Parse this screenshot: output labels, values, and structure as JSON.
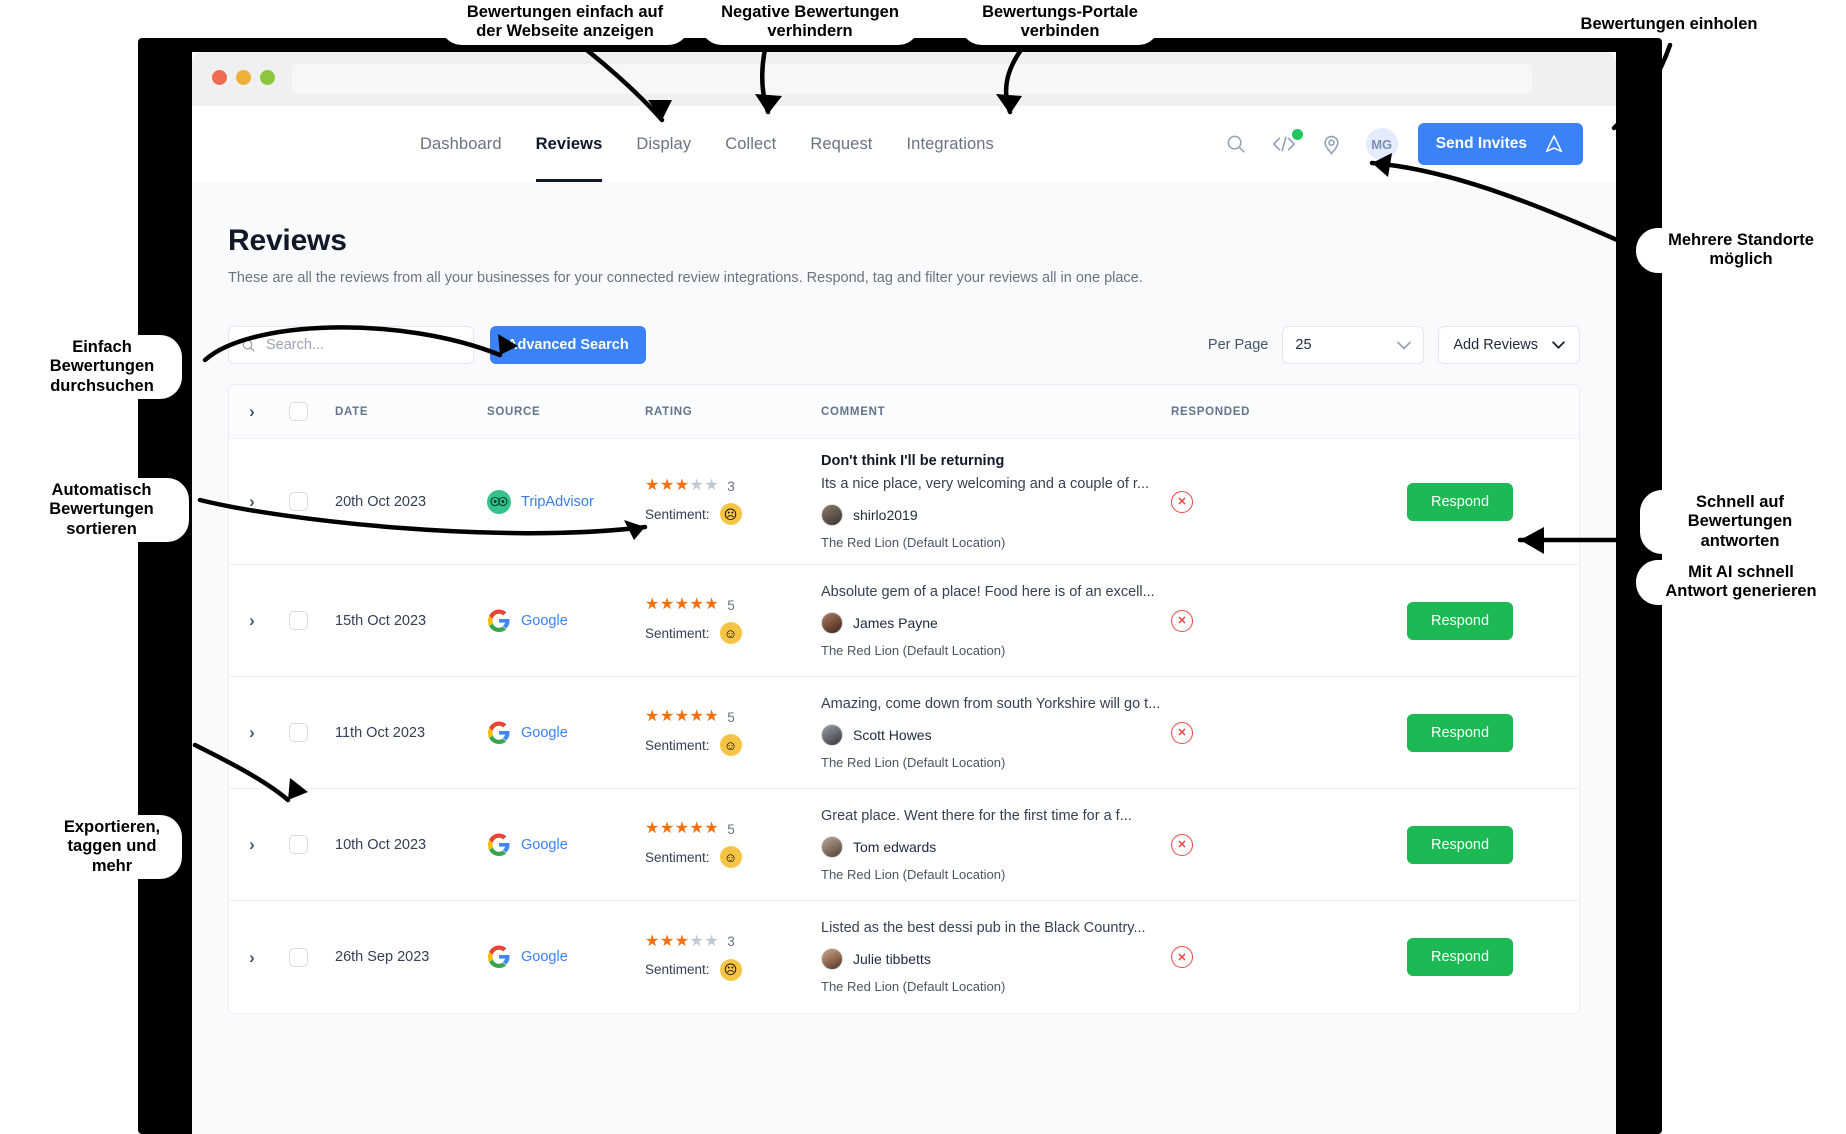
{
  "browser": {
    "traffic_lights": [
      "close-red",
      "minimize-yellow",
      "maximize-green"
    ],
    "url_value": ""
  },
  "nav": {
    "items": [
      {
        "label": "Dashboard",
        "active": false
      },
      {
        "label": "Reviews",
        "active": true
      },
      {
        "label": "Display",
        "active": false
      },
      {
        "label": "Collect",
        "active": false
      },
      {
        "label": "Request",
        "active": false
      },
      {
        "label": "Integrations",
        "active": false
      }
    ],
    "icons": [
      "search-icon",
      "code-embed-icon",
      "location-pin-icon"
    ],
    "status_dot_color": "#22c55e",
    "avatar_initials": "MG",
    "send_invites_label": "Send Invites"
  },
  "page": {
    "title": "Reviews",
    "subtitle": "These are all the reviews from all your businesses for your connected review integrations. Respond, tag and filter your reviews all in one place."
  },
  "filters": {
    "search_placeholder": "Search...",
    "search_value": "",
    "advanced_search_label": "Advanced Search",
    "per_page_label": "Per Page",
    "per_page_value": "25",
    "add_reviews_label": "Add Reviews"
  },
  "table": {
    "columns": [
      "DATE",
      "SOURCE",
      "RATING",
      "COMMENT",
      "RESPONDED"
    ],
    "sentiment_label": "Sentiment:",
    "respond_label": "Respond",
    "rows": [
      {
        "date": "20th Oct 2023",
        "source": "TripAdvisor",
        "source_kind": "tripadvisor",
        "rating": 3,
        "rating_max": 5,
        "sentiment": "negative",
        "comment_title": "Don't think I'll be returning",
        "comment_text": "Its a nice place, very welcoming and a couple of r...",
        "author": "shirlo2019",
        "location": "The Red Lion (Default Location)",
        "responded": false
      },
      {
        "date": "15th Oct 2023",
        "source": "Google",
        "source_kind": "google",
        "rating": 5,
        "rating_max": 5,
        "sentiment": "positive",
        "comment_title": "",
        "comment_text": "Absolute gem of a place! Food here is of an excell...",
        "author": "James Payne",
        "location": "The Red Lion (Default Location)",
        "responded": false
      },
      {
        "date": "11th Oct 2023",
        "source": "Google",
        "source_kind": "google",
        "rating": 5,
        "rating_max": 5,
        "sentiment": "positive",
        "comment_title": "",
        "comment_text": "Amazing, come down from south Yorkshire will go t...",
        "author": "Scott Howes",
        "location": "The Red Lion (Default Location)",
        "responded": false
      },
      {
        "date": "10th Oct 2023",
        "source": "Google",
        "source_kind": "google",
        "rating": 5,
        "rating_max": 5,
        "sentiment": "positive",
        "comment_title": "",
        "comment_text": "Great place. Went there for the first time for a f...",
        "author": "Tom edwards",
        "location": "The Red Lion (Default Location)",
        "responded": false
      },
      {
        "date": "26th Sep 2023",
        "source": "Google",
        "source_kind": "google",
        "rating": 3,
        "rating_max": 5,
        "sentiment": "negative",
        "comment_title": "",
        "comment_text": "Listed as the best dessi pub in the Black Country...",
        "author": "Julie tibbetts",
        "location": "The Red Lion (Default Location)",
        "responded": false
      }
    ]
  },
  "annotations": [
    {
      "id": "display-on-website",
      "text": "Bewertungen einfach auf\nder Webseite anzeigen"
    },
    {
      "id": "prevent-negative",
      "text": "Negative Bewertungen\nverhindern"
    },
    {
      "id": "connect-portals",
      "text": "Bewertungs-Portale\nverbinden"
    },
    {
      "id": "collect-reviews",
      "text": "Bewertungen einholen"
    },
    {
      "id": "multiple-locations",
      "text": "Mehrere Standorte\nmöglich"
    },
    {
      "id": "easy-search",
      "text": "Einfach\nBewertungen\ndurchsuchen"
    },
    {
      "id": "auto-sort",
      "text": "Automatisch\nBewertungen\nsortieren"
    },
    {
      "id": "export-tag",
      "text": "Exportieren,\ntaggen und\nmehr"
    },
    {
      "id": "quick-reply",
      "text": "Schnell auf\nBewertungen\nantworten"
    },
    {
      "id": "ai-reply",
      "text": "Mit AI schnell\nAntwort generieren"
    }
  ],
  "colors": {
    "accent_blue": "#3b82f6",
    "respond_green": "#1db954",
    "status_green": "#22c55e",
    "star_orange": "#f2700f",
    "danger_red": "#ef4444"
  }
}
